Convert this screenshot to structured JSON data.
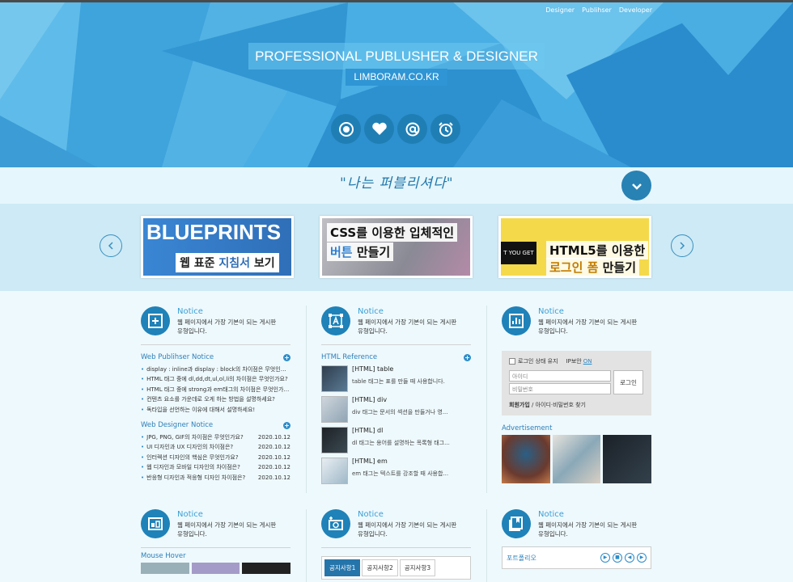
{
  "nav": [
    "Designer",
    "Publihser",
    "Developer"
  ],
  "hero": {
    "title": "PROFESSIONAL PUBLUSHER & DESIGNER",
    "subtitle": "LIMBORAM.CO.KR"
  },
  "quote": "\"나는 퍼블리셔다\"",
  "slides": [
    {
      "big": "BLUEPRINTS",
      "label_a": "웹 표준 ",
      "label_b": "지침서",
      "label_c": " 보기"
    },
    {
      "line1": "CSS를 이용한 입체적인",
      "line2_a": "버튼",
      "line2_b": " 만들기"
    },
    {
      "black": "T YOU GET",
      "line1": "HTML5를 이용한",
      "line2_a": "로그인 폼",
      "line2_b": " 만들기"
    }
  ],
  "notice": {
    "title": "Notice",
    "desc1": "웹 페이지에서 가장 기본이 되는 게시판",
    "desc2": "유형입니다."
  },
  "col1": {
    "h1": "Web Publihser Notice",
    "items1": [
      "display : inline과 display : block의 차이점은 무엇인가요?",
      "HTML 태그 중에 dl,dd,dt,ul,ol,li의 차이점은 무엇인가요?",
      "HTML 태그 중에 strong과 em태그의 차이점은 무엇인가요?",
      "컨텐츠 요소를 가운데로 오게 하는 방법을 설명하세요?",
      "독타입을 선언하는 이유에 대해서 설명하세요!"
    ],
    "h2": "Web Designer Notice",
    "items2": [
      {
        "t": "JPG, PNG, GIF의 차이점은 무엇인가요?",
        "d": "2020.10.12"
      },
      {
        "t": "UI 디자인과 UX 디자인의 차이점은?",
        "d": "2020.10.12"
      },
      {
        "t": "인터렉션 디자인의 핵심은 무엇인가요?",
        "d": "2020.10.12"
      },
      {
        "t": "웹 디자인과 모바일 디자인의 차이점은?",
        "d": "2020.10.12"
      },
      {
        "t": "반응형 디자인과 적응형 디자인 차이점은?",
        "d": "2020.10.12"
      }
    ]
  },
  "col2": {
    "h1": "HTML Reference",
    "refs": [
      {
        "a": "[HTML] table",
        "b": "table 태그는 표를 만들 때 사용합니다."
      },
      {
        "a": "[HTML] div",
        "b": "div 태그는 문서의 섹션을 만들거나 영..."
      },
      {
        "a": "[HTML] dl",
        "b": "dl 태그는 용어를 설명하는 목록형 태그..."
      },
      {
        "a": "[HTML] em",
        "b": "em 태그는 텍스트를 강조할 때 사용합..."
      }
    ],
    "tabs": [
      "공지사항1",
      "공지사항2",
      "공지사항3"
    ]
  },
  "col3": {
    "keep": "로그인 상태 유지",
    "ip": "IP보안",
    "on": "ON",
    "id_ph": "아이디",
    "pw_ph": "비밀번호",
    "login": "로그인",
    "join": "회원가입",
    "find": " / 아이디·비밀번호 찾기",
    "ad": "Advertisement",
    "portfolio": "포트폴리오"
  },
  "bottom": {
    "hover": "Mouse Hover"
  },
  "colors": {
    "accent": "#1f82b8",
    "hero": "#49aee3"
  }
}
